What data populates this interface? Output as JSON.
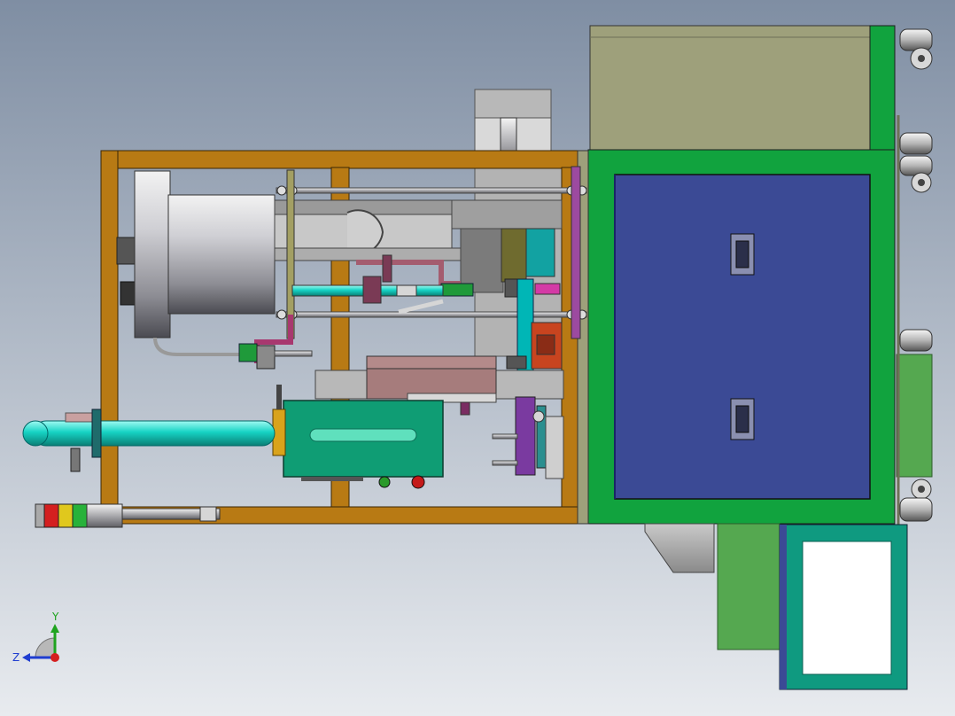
{
  "axis_triad": {
    "y_label": "Y",
    "z_label": "Z"
  },
  "colors": {
    "background_top": "#7f8ea3",
    "background_bottom": "#e8ebef",
    "frame_wood": "#b87a14",
    "frame_green": "#11a33e",
    "cabinet_panel": "#9ea07b",
    "door_blue": "#3b4a95",
    "cylinder_cyan": "#16d3c4",
    "block_teal": "#0f9d74",
    "light_red": "#d41f1f",
    "light_yellow": "#e0c81d",
    "light_green": "#27b23a"
  },
  "icons": {
    "coordinate_triad": "xyz-axis-triad-icon",
    "door_handle": "door-handle-icon",
    "caster_wheel": "caster-wheel-icon",
    "signal_tower": "signal-tower-light-icon"
  }
}
